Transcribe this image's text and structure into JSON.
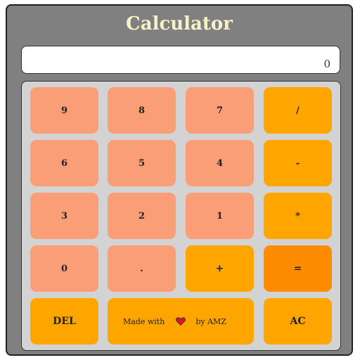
{
  "title": "Calculator",
  "display": {
    "value": "0"
  },
  "keys": {
    "k9": "9",
    "k8": "8",
    "k7": "7",
    "divide": "/",
    "k6": "6",
    "k5": "5",
    "k4": "4",
    "minus": "-",
    "k3": "3",
    "k2": "2",
    "k1": "1",
    "multiply": "*",
    "k0": "0",
    "dot": ".",
    "plus": "+",
    "equals": "=",
    "del": "DEL",
    "ac": "AC"
  },
  "credit": {
    "prefix": "Made with",
    "icon": "heart-icon",
    "suffix": "by AMZ"
  },
  "colors": {
    "frame": "#808080",
    "keypad_bg": "#d3d3d3",
    "number_key": "#fa9e78",
    "operator_key": "#ffa500",
    "equals_key": "#ff8c00",
    "title": "#f5f1c9",
    "heart": "#e0102a"
  }
}
